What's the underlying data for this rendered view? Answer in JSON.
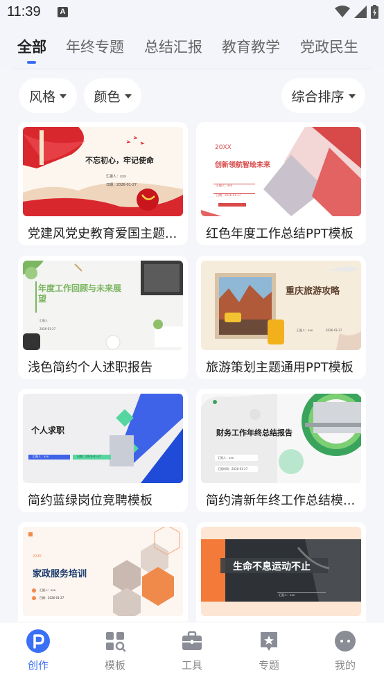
{
  "status_bar": {
    "time": "11:39",
    "app_icon_letter": "A"
  },
  "tabs": [
    {
      "label": "全部",
      "active": true
    },
    {
      "label": "年终专题",
      "active": false
    },
    {
      "label": "总结汇报",
      "active": false
    },
    {
      "label": "教育教学",
      "active": false
    },
    {
      "label": "党政民生",
      "active": false
    }
  ],
  "filters": {
    "style": "风格",
    "color": "颜色",
    "sort": "综合排序"
  },
  "templates": [
    {
      "title": "党建风党史教育爱国主题...",
      "thumb": {
        "heading": "不忘初心，牢记使命",
        "line1": "汇报人：xxx",
        "line2": "日期：2026-01-27"
      }
    },
    {
      "title": "红色年度工作总结PPT模板",
      "thumb": {
        "top": "20XX",
        "heading": "创新领航智绘未来",
        "line1": "汇报人：xxx",
        "line2": "日期：2026-01-27"
      }
    },
    {
      "title": "浅色简约个人述职报告",
      "thumb": {
        "heading": "年度工作回顾与未来展望",
        "line1": "汇报人",
        "line2": "2026-01-27"
      }
    },
    {
      "title": "旅游策划主题通用PPT模板",
      "thumb": {
        "heading": "重庆旅游攻略",
        "line1": "汇报人：xxx",
        "line2": "2026-01-27"
      }
    },
    {
      "title": "简约蓝绿岗位竞聘模板",
      "thumb": {
        "heading": "个人求职",
        "line1": "汇报人：xxx",
        "line2": "日期：2026-01-27"
      }
    },
    {
      "title": "简约清新年终工作总结模...",
      "thumb": {
        "heading": "财务工作年终总结报告",
        "line1": "汇报人：xxx",
        "line2": "汇报时间：2026-01-27"
      }
    },
    {
      "title": "",
      "thumb": {
        "top": "2026",
        "heading": "家政服务培训",
        "line1": "汇报人：xxx",
        "line2": "日期：2026-01-27"
      }
    },
    {
      "title": "",
      "thumb": {
        "heading": "生命不息运动不止",
        "line1": "汇报人：xxx"
      }
    }
  ],
  "bottom_nav": [
    {
      "label": "创作",
      "icon": "create-icon",
      "active": true
    },
    {
      "label": "模板",
      "icon": "template-icon",
      "active": false
    },
    {
      "label": "工具",
      "icon": "toolbox-icon",
      "active": false
    },
    {
      "label": "专题",
      "icon": "topic-icon",
      "active": false
    },
    {
      "label": "我的",
      "icon": "profile-icon",
      "active": false
    }
  ],
  "colors": {
    "accent": "#3b6ff6",
    "background": "#f5f6fa"
  }
}
